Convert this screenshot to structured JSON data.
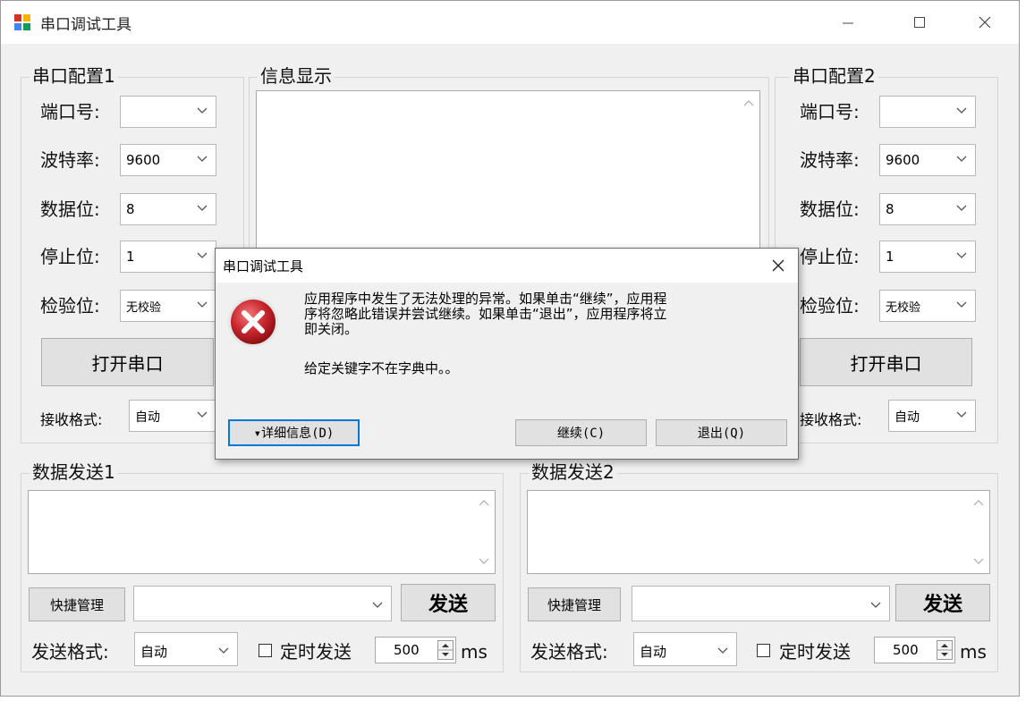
{
  "app": {
    "title": "串口调试工具"
  },
  "config1": {
    "title": "串口配置1",
    "port_label": "端口号:",
    "port_value": "",
    "baud_label": "波特率:",
    "baud_value": "9600",
    "databits_label": "数据位:",
    "databits_value": "8",
    "stopbits_label": "停止位:",
    "stopbits_value": "1",
    "parity_label": "检验位:",
    "parity_value": "无校验",
    "open_button": "打开串口",
    "recv_format_label": "接收格式:",
    "recv_format_value": "自动"
  },
  "config2": {
    "title": "串口配置2",
    "port_label": "端口号:",
    "port_value": "",
    "baud_label": "波特率:",
    "baud_value": "9600",
    "databits_label": "数据位:",
    "databits_value": "8",
    "stopbits_label": "停止位:",
    "stopbits_value": "1",
    "parity_label": "检验位:",
    "parity_value": "无校验",
    "open_button": "打开串口",
    "recv_format_label": "接收格式:",
    "recv_format_value": "自动"
  },
  "info": {
    "title": "信息显示",
    "content": ""
  },
  "send1": {
    "title": "数据发送1",
    "content": "",
    "quick_button": "快捷管理",
    "quick_value": "",
    "send_button": "发送",
    "format_label": "发送格式:",
    "format_value": "自动",
    "timed_label": "定时发送",
    "timed_checked": false,
    "interval_value": "500",
    "unit": "ms"
  },
  "send2": {
    "title": "数据发送2",
    "content": "",
    "quick_button": "快捷管理",
    "quick_value": "",
    "send_button": "发送",
    "format_label": "发送格式:",
    "format_value": "自动",
    "timed_label": "定时发送",
    "timed_checked": false,
    "interval_value": "500",
    "unit": "ms"
  },
  "dialog": {
    "title": "串口调试工具",
    "message_line1": "应用程序中发生了无法处理的异常。如果单击“继续”，应用程",
    "message_line2": "序将忽略此错误并尝试继续。如果单击“退出”，应用程序将立",
    "message_line3": "即关闭。",
    "detail": "给定关键字不在字典中。。",
    "details_button": "▾详细信息(D)",
    "continue_button": "继续(C)",
    "quit_button": "退出(Q)",
    "icon": "error-icon"
  },
  "colors": {
    "error_red": "#c8252c",
    "focus_blue": "#0078d7"
  }
}
